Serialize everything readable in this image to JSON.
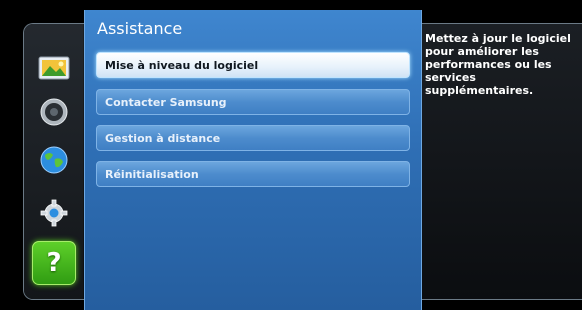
{
  "sidebar": {
    "items": [
      {
        "name": "image",
        "icon": "picture-icon"
      },
      {
        "name": "sound",
        "icon": "speaker-icon"
      },
      {
        "name": "network",
        "icon": "globe-icon"
      },
      {
        "name": "system",
        "icon": "gear-icon"
      },
      {
        "name": "support",
        "icon": "question-icon",
        "active": true,
        "glyph": "?"
      }
    ]
  },
  "panel": {
    "title": "Assistance",
    "items": [
      {
        "label": "Mise à niveau du logiciel",
        "selected": true
      },
      {
        "label": "Contacter Samsung",
        "selected": false
      },
      {
        "label": "Gestion à distance",
        "selected": false
      },
      {
        "label": "Réinitialisation",
        "selected": false
      }
    ]
  },
  "help": {
    "text": "Mettez à jour le logiciel pour améliorer les performances ou les services supplémentaires."
  },
  "colors": {
    "panel_blue": "#2f6fb5",
    "active_green": "#4bbf1c",
    "background": "#000000"
  }
}
